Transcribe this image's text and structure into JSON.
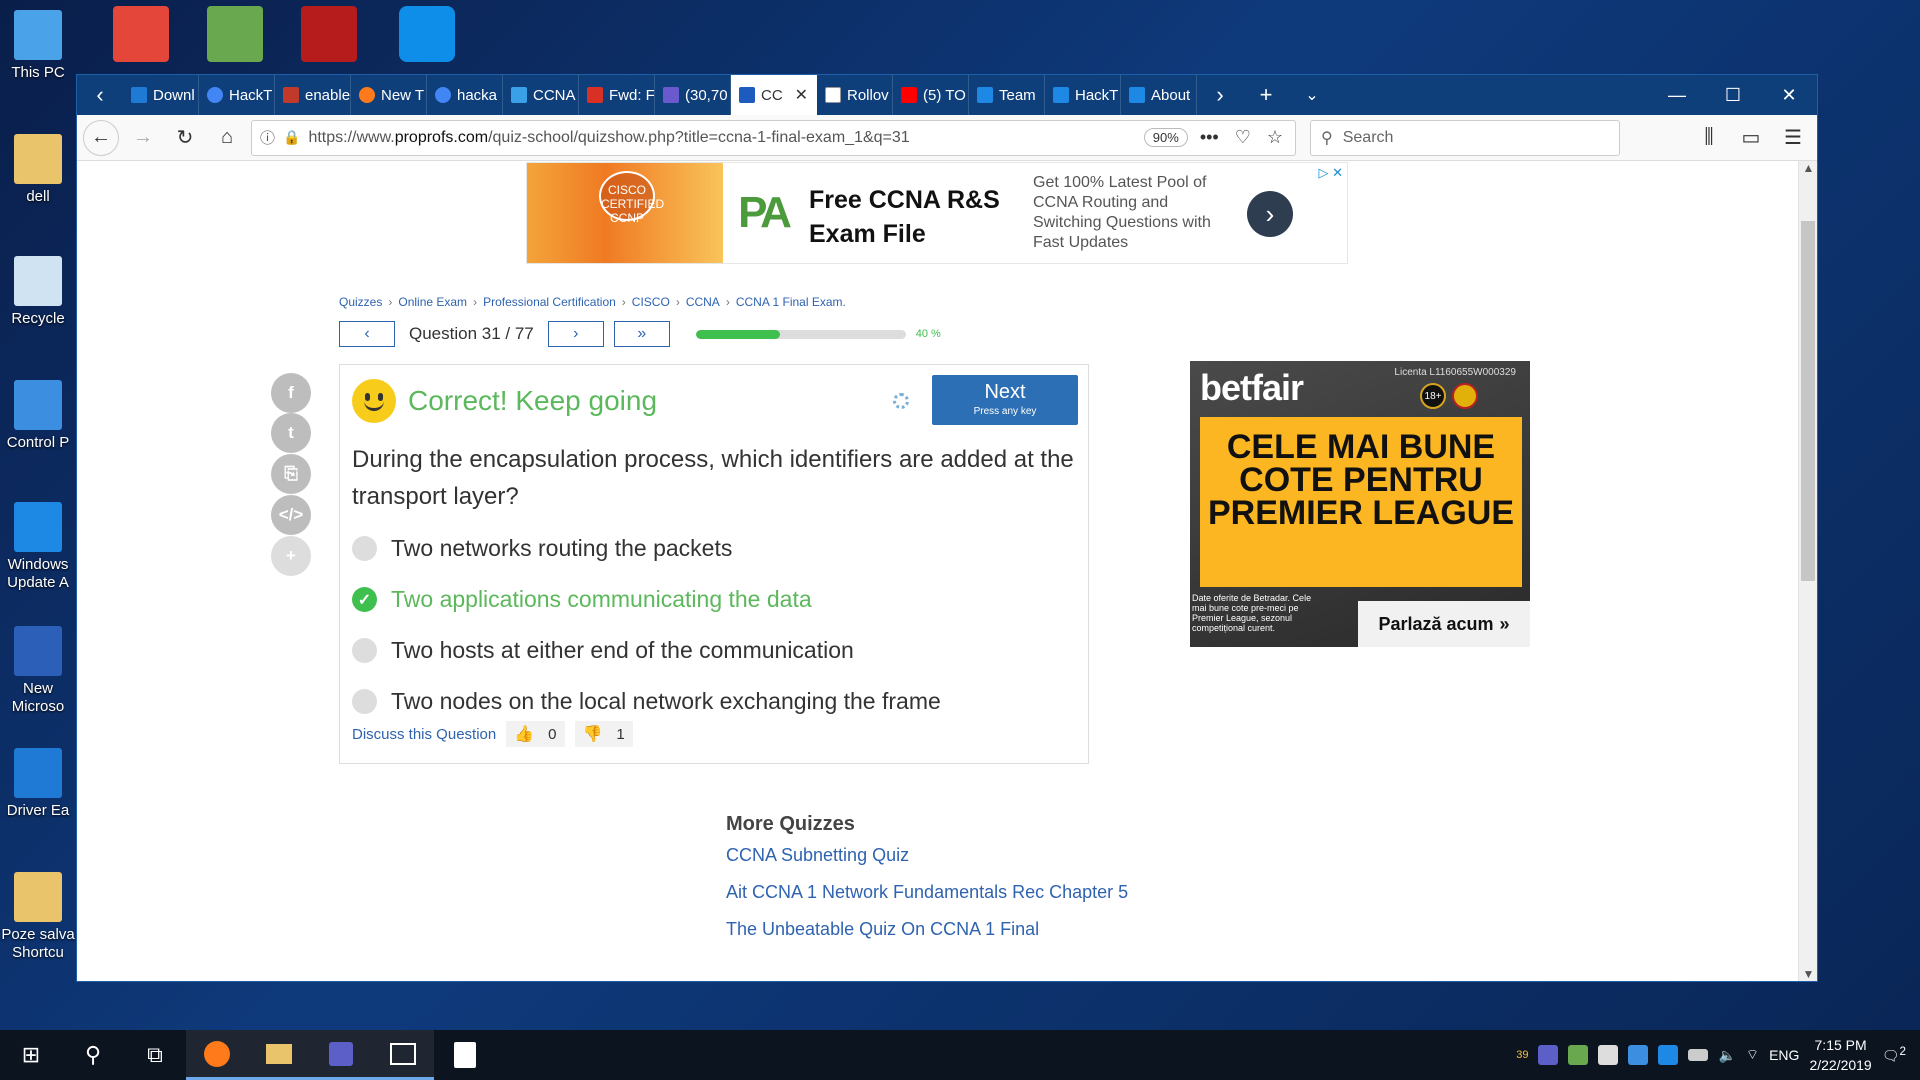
{
  "desktop": {
    "icons": [
      {
        "label": "This PC",
        "color": "#4aa3e8"
      },
      {
        "label": "dell",
        "color": "#e9c46a"
      },
      {
        "label": "Recycle",
        "color": "#cfe3f2"
      },
      {
        "label": "Control P",
        "color": "#3b8ee0"
      },
      {
        "label": "Windows Update A",
        "color": "#1e88e5"
      },
      {
        "label": "New Microso",
        "color": "#2b5fb8"
      },
      {
        "label": "Driver Ea",
        "color": "#1f7ad6"
      },
      {
        "label": "Poze salva Shortcu",
        "color": "#e9c46a"
      }
    ]
  },
  "browser": {
    "tabs": [
      {
        "label": "Downl",
        "color": "#1f7ad6"
      },
      {
        "label": "HackT",
        "color": "#4285f4"
      },
      {
        "label": "enable",
        "color": "#c0392b"
      },
      {
        "label": "New T",
        "color": "#ff7a1a"
      },
      {
        "label": "hacka",
        "color": "#4285f4"
      },
      {
        "label": "CCNA",
        "color": "#3aa0e8"
      },
      {
        "label": "Fwd: F",
        "color": "#d93025"
      },
      {
        "label": "(30,70",
        "color": "#6a5acd"
      },
      {
        "label": "CC",
        "color": "#1e5bbf",
        "active": true
      },
      {
        "label": "Rollov",
        "color": "#ffffff"
      },
      {
        "label": "(5) TO",
        "color": "#ff0000"
      },
      {
        "label": "Team",
        "color": "#1e88e5"
      },
      {
        "label": "HackT",
        "color": "#1e88e5"
      },
      {
        "label": "About",
        "color": "#1e88e5"
      }
    ],
    "url_prefix": "https://www.",
    "url_domain": "proprofs.com",
    "url_path": "/quiz-school/quizshow.php?title=ccna-1-final-exam_1&q=31",
    "zoom": "90%",
    "search_placeholder": "Search"
  },
  "top_ad": {
    "badge": "CISCO CERTIFIED CCNP",
    "logo": "PA",
    "headline": "Free CCNA R&S Exam File",
    "description": "Get 100% Latest Pool of CCNA Routing and Switching Questions with Fast Updates"
  },
  "breadcrumbs": [
    "Quizzes",
    "Online Exam",
    "Professional Certification",
    "CISCO",
    "CCNA",
    "CCNA 1 Final Exam."
  ],
  "quiz": {
    "question_counter": "Question 31 / 77",
    "progress_pct": 40,
    "progress_label": "40 %",
    "status_message": "Correct! Keep going",
    "next_label": "Next",
    "next_hint": "Press any key",
    "question": "During the encapsulation process, which identifiers are added at the transport layer?",
    "answers": [
      {
        "text": "Two networks routing the packets",
        "correct": false
      },
      {
        "text": "Two applications communicating the data",
        "correct": true
      },
      {
        "text": "Two hosts at either end of the communication",
        "correct": false
      },
      {
        "text": "Two nodes on the local network exchanging the frame",
        "correct": false
      }
    ],
    "discuss_label": "Discuss this Question",
    "upvotes": "0",
    "downvotes": "1"
  },
  "side_ad": {
    "brand": "betfair",
    "license": "Licenta L1160655W000329",
    "age": "18+",
    "headline": "CELE MAI BUNE COTE PENTRU PREMIER LEAGUE",
    "fine_print": "Date oferite de Betradar. Cele mai bune cote pre-meci pe Premier League, sezonul competițional curent.",
    "cta": "Parlază acum"
  },
  "more_quizzes": {
    "heading": "More Quizzes",
    "links": [
      "CCNA Subnetting Quiz",
      "Ait CCNA 1 Network Fundamentals Rec Chapter 5",
      "The Unbeatable Quiz On CCNA 1 Final"
    ]
  },
  "taskbar": {
    "time": "7:15 PM",
    "date": "2/22/2019",
    "lang": "ENG",
    "notif_count": "2",
    "tray_number": "39"
  }
}
